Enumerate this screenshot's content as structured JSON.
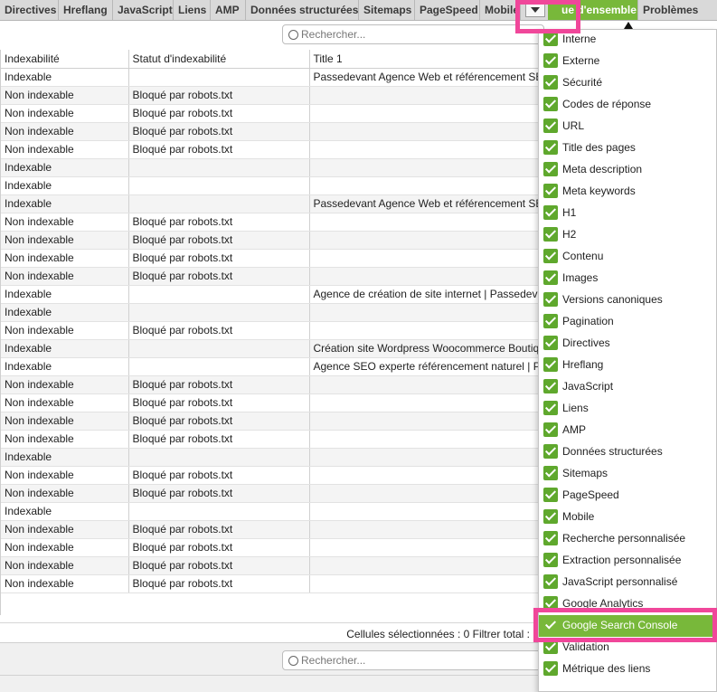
{
  "tabs": [
    {
      "label": "Directives",
      "width": 65
    },
    {
      "label": "Hreflang",
      "width": 60
    },
    {
      "label": "JavaScript",
      "width": 67
    },
    {
      "label": "Liens",
      "width": 41
    },
    {
      "label": "AMP",
      "width": 39
    },
    {
      "label": "Données structurées",
      "width": 125
    },
    {
      "label": "Sitemaps",
      "width": 62
    },
    {
      "label": "PageSpeed",
      "width": 72
    },
    {
      "label": "Mobile",
      "width": 45
    }
  ],
  "active_tab": "ue d'ensemble",
  "problems_tab": "Problèmes",
  "search": {
    "placeholder": "Rechercher..."
  },
  "columns": [
    "Indexabilité",
    "Statut d'indexabilité",
    "Title 1"
  ],
  "rows": [
    [
      "Indexable",
      "",
      "Passedevant Agence Web et référencement SEO"
    ],
    [
      "Non indexable",
      "Bloqué par robots.txt",
      ""
    ],
    [
      "Non indexable",
      "Bloqué par robots.txt",
      ""
    ],
    [
      "Non indexable",
      "Bloqué par robots.txt",
      ""
    ],
    [
      "Non indexable",
      "Bloqué par robots.txt",
      ""
    ],
    [
      "Indexable",
      "",
      ""
    ],
    [
      "Indexable",
      "",
      ""
    ],
    [
      "Indexable",
      "",
      "Passedevant Agence Web et référencement SEO"
    ],
    [
      "Non indexable",
      "Bloqué par robots.txt",
      ""
    ],
    [
      "Non indexable",
      "Bloqué par robots.txt",
      ""
    ],
    [
      "Non indexable",
      "Bloqué par robots.txt",
      ""
    ],
    [
      "Non indexable",
      "Bloqué par robots.txt",
      ""
    ],
    [
      "Indexable",
      "",
      "Agence de création de site internet | Passedevant"
    ],
    [
      "Indexable",
      "",
      ""
    ],
    [
      "Non indexable",
      "Bloqué par robots.txt",
      ""
    ],
    [
      "Indexable",
      "",
      "Création site Wordpress Woocommerce Boutique"
    ],
    [
      "Indexable",
      "",
      "Agence SEO experte référencement naturel | Passedevant"
    ],
    [
      "Non indexable",
      "Bloqué par robots.txt",
      ""
    ],
    [
      "Non indexable",
      "Bloqué par robots.txt",
      ""
    ],
    [
      "Non indexable",
      "Bloqué par robots.txt",
      ""
    ],
    [
      "Non indexable",
      "Bloqué par robots.txt",
      ""
    ],
    [
      "Indexable",
      "",
      ""
    ],
    [
      "Non indexable",
      "Bloqué par robots.txt",
      ""
    ],
    [
      "Non indexable",
      "Bloqué par robots.txt",
      ""
    ],
    [
      "Indexable",
      "",
      ""
    ],
    [
      "Non indexable",
      "Bloqué par robots.txt",
      ""
    ],
    [
      "Non indexable",
      "Bloqué par robots.txt",
      ""
    ],
    [
      "Non indexable",
      "Bloqué par robots.txt",
      ""
    ],
    [
      "Non indexable",
      "Bloqué par robots.txt",
      ""
    ]
  ],
  "status": {
    "text": "Cellules sélectionnées :  0  Filtrer total :"
  },
  "menu_items": [
    {
      "label": "Interne",
      "checked": true
    },
    {
      "label": "Externe",
      "checked": true
    },
    {
      "label": "Sécurité",
      "checked": true
    },
    {
      "label": "Codes de réponse",
      "checked": true
    },
    {
      "label": "URL",
      "checked": true
    },
    {
      "label": "Title des pages",
      "checked": true
    },
    {
      "label": "Meta description",
      "checked": true
    },
    {
      "label": "Meta keywords",
      "checked": true
    },
    {
      "label": "H1",
      "checked": true
    },
    {
      "label": "H2",
      "checked": true
    },
    {
      "label": "Contenu",
      "checked": true
    },
    {
      "label": "Images",
      "checked": true
    },
    {
      "label": "Versions canoniques",
      "checked": true
    },
    {
      "label": "Pagination",
      "checked": true
    },
    {
      "label": "Directives",
      "checked": true
    },
    {
      "label": "Hreflang",
      "checked": true
    },
    {
      "label": "JavaScript",
      "checked": true
    },
    {
      "label": "Liens",
      "checked": true
    },
    {
      "label": "AMP",
      "checked": true
    },
    {
      "label": "Données structurées",
      "checked": true
    },
    {
      "label": "Sitemaps",
      "checked": true
    },
    {
      "label": "PageSpeed",
      "checked": true
    },
    {
      "label": "Mobile",
      "checked": true
    },
    {
      "label": "Recherche personnalisée",
      "checked": true
    },
    {
      "label": "Extraction personnalisée",
      "checked": true
    },
    {
      "label": "JavaScript personnalisé",
      "checked": true
    },
    {
      "label": "Google Analytics",
      "checked": true
    },
    {
      "label": "Google Search Console",
      "checked": true,
      "highlighted": true
    },
    {
      "label": "Validation",
      "checked": true
    },
    {
      "label": "Métrique des liens",
      "checked": true
    }
  ],
  "colors": {
    "accent_green": "#78b83a",
    "checkbox_green": "#5fa82d",
    "annotation_pink": "#f0479a"
  }
}
